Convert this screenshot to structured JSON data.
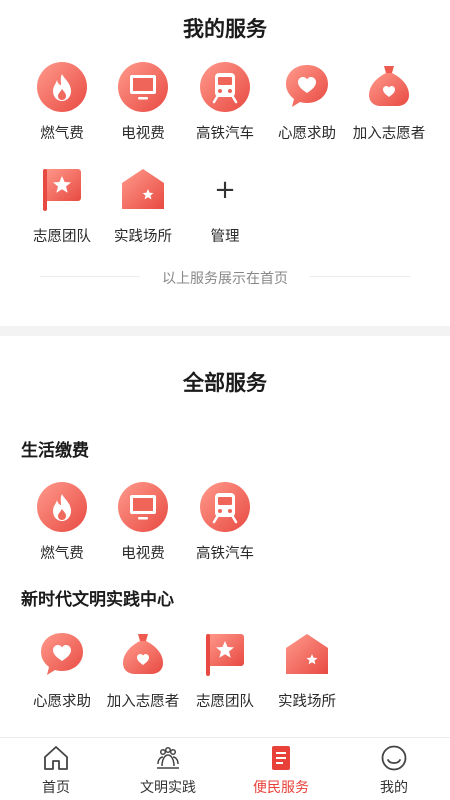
{
  "my_services": {
    "title": "我的服务",
    "items": [
      {
        "label": "燃气费",
        "icon": "flame-icon"
      },
      {
        "label": "电视费",
        "icon": "tv-icon"
      },
      {
        "label": "高铁汽车",
        "icon": "train-icon"
      },
      {
        "label": "心愿求助",
        "icon": "heart-bubble-icon"
      },
      {
        "label": "加入志愿者",
        "icon": "volunteer-bag-icon"
      },
      {
        "label": "志愿团队",
        "icon": "star-flag-icon"
      },
      {
        "label": "实践场所",
        "icon": "house-star-icon"
      }
    ],
    "manage_label": "管理",
    "note": "以上服务展示在首页"
  },
  "all_services": {
    "title": "全部服务",
    "categories": [
      {
        "name": "生活缴费",
        "items": [
          {
            "label": "燃气费",
            "icon": "flame-icon"
          },
          {
            "label": "电视费",
            "icon": "tv-icon"
          },
          {
            "label": "高铁汽车",
            "icon": "train-icon"
          }
        ]
      },
      {
        "name": "新时代文明实践中心",
        "items": [
          {
            "label": "心愿求助",
            "icon": "heart-bubble-icon"
          },
          {
            "label": "加入志愿者",
            "icon": "volunteer-bag-icon"
          },
          {
            "label": "志愿团队",
            "icon": "star-flag-icon"
          },
          {
            "label": "实践场所",
            "icon": "house-star-icon"
          }
        ]
      }
    ]
  },
  "tabbar": {
    "tabs": [
      {
        "label": "首页",
        "icon": "home-icon"
      },
      {
        "label": "文明实践",
        "icon": "civilization-icon"
      },
      {
        "label": "便民服务",
        "icon": "document-icon",
        "active": true
      },
      {
        "label": "我的",
        "icon": "smiley-icon"
      }
    ]
  },
  "colors": {
    "accent": "#e8413a",
    "icon_light": "#ff8a7c",
    "icon_dark": "#ec4f47"
  }
}
